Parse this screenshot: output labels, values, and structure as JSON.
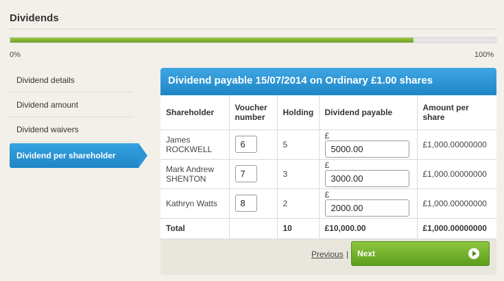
{
  "header": {
    "title": "Dividends"
  },
  "progress": {
    "value_percent": 83,
    "min_label": "0%",
    "max_label": "100%"
  },
  "steps": [
    {
      "label": "Dividend details"
    },
    {
      "label": "Dividend amount"
    },
    {
      "label": "Dividend waivers"
    },
    {
      "label": "Dividend per shareholder",
      "active": true
    }
  ],
  "panel": {
    "title": "Dividend payable 15/07/2014 on Ordinary £1.00 shares",
    "columns": {
      "shareholder": "Shareholder",
      "voucher": "Voucher number",
      "holding": "Holding",
      "dividend": "Dividend payable",
      "per_share": "Amount per share"
    },
    "currency_symbol": "£",
    "rows": [
      {
        "shareholder": "James ROCKWELL",
        "voucher": "6",
        "holding": "5",
        "dividend": "5000.00",
        "per_share": "£1,000.00000000"
      },
      {
        "shareholder": "Mark Andrew SHENTON",
        "voucher": "7",
        "holding": "3",
        "dividend": "3000.00",
        "per_share": "£1,000.00000000"
      },
      {
        "shareholder": "Kathryn Watts",
        "voucher": "8",
        "holding": "2",
        "dividend": "2000.00",
        "per_share": "£1,000.00000000"
      }
    ],
    "total": {
      "label": "Total",
      "holding": "10",
      "dividend": "£10,000.00",
      "per_share": "£1,000.00000000"
    }
  },
  "nav": {
    "previous_label": "Previous",
    "separator": "|",
    "next_label": "Next"
  },
  "colors": {
    "accent_blue": "#1f86c6",
    "progress_green": "#7ab02e",
    "next_green": "#6aab27"
  }
}
